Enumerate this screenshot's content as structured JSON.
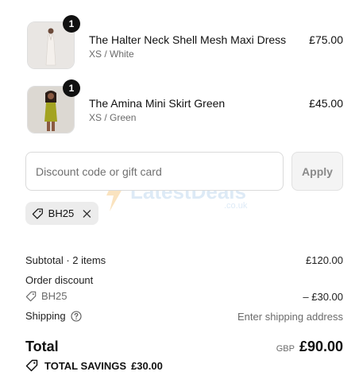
{
  "line_items": [
    {
      "name": "The Halter Neck Shell Mesh Maxi Dress",
      "variant": "XS / White",
      "price": "£75.00",
      "quantity": "1"
    },
    {
      "name": "The Amina Mini Skirt Green",
      "variant": "XS / Green",
      "price": "£45.00",
      "quantity": "1"
    }
  ],
  "discount": {
    "placeholder": "Discount code or gift card",
    "apply_label": "Apply",
    "applied_code": "BH25"
  },
  "summary": {
    "subtotal_label": "Subtotal · 2 items",
    "subtotal_value": "£120.00",
    "order_discount_label": "Order discount",
    "discount_code": "BH25",
    "discount_value": "– £30.00",
    "shipping_label": "Shipping",
    "shipping_value": "Enter shipping address",
    "total_label": "Total",
    "currency": "GBP",
    "total_value": "£90.00",
    "savings_label": "TOTAL SAVINGS",
    "savings_value": "£30.00"
  },
  "watermark": {
    "brand": "LatestDeals",
    "domain": ".co.uk"
  },
  "icons": {
    "tag": "tag-icon",
    "close": "close-icon",
    "help": "help-circle-icon"
  },
  "colors": {
    "dress_white": "#efe9e4",
    "skirt_green": "#a3a321",
    "badge": "#111111"
  }
}
